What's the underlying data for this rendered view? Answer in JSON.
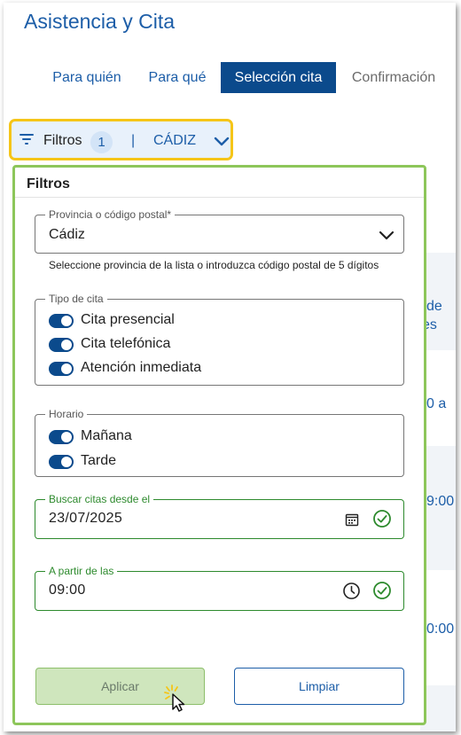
{
  "header": {
    "title": "Asistencia y Cita"
  },
  "steps": [
    {
      "label": "Para quién"
    },
    {
      "label": "Para qué"
    },
    {
      "label": "Selección cita"
    },
    {
      "label": "Confirmación"
    }
  ],
  "filter_button": {
    "label": "Filtros",
    "count": "1",
    "separator": "|",
    "province": "CÁDIZ"
  },
  "background_text": {
    "b1": "de",
    "b2": "es",
    "b3": "0 a",
    "b4": "9:00",
    "b5": "0:00"
  },
  "panel": {
    "title": "Filtros",
    "province": {
      "legend": "Provincia o código postal*",
      "value": "Cádiz",
      "hint": "Seleccione provincia de la lista o introduzca código postal de 5 dígitos"
    },
    "appointment_type": {
      "legend": "Tipo de cita",
      "options": [
        {
          "label": "Cita presencial",
          "on": true
        },
        {
          "label": "Cita telefónica",
          "on": true
        },
        {
          "label": "Atención inmediata",
          "on": true
        }
      ]
    },
    "schedule": {
      "legend": "Horario",
      "options": [
        {
          "label": "Mañana",
          "on": true
        },
        {
          "label": "Tarde",
          "on": true
        }
      ]
    },
    "date": {
      "legend": "Buscar citas desde el",
      "value": "23/07/2025"
    },
    "time": {
      "legend": "A partir de las",
      "value": "09:00"
    },
    "apply_label": "Aplicar",
    "clear_label": "Limpiar"
  },
  "colors": {
    "primary": "#1d5ea8",
    "active_step": "#0b4a8c",
    "highlight": "#f5c518",
    "panel_border": "#8dc65a",
    "valid": "#2d8a2d"
  }
}
